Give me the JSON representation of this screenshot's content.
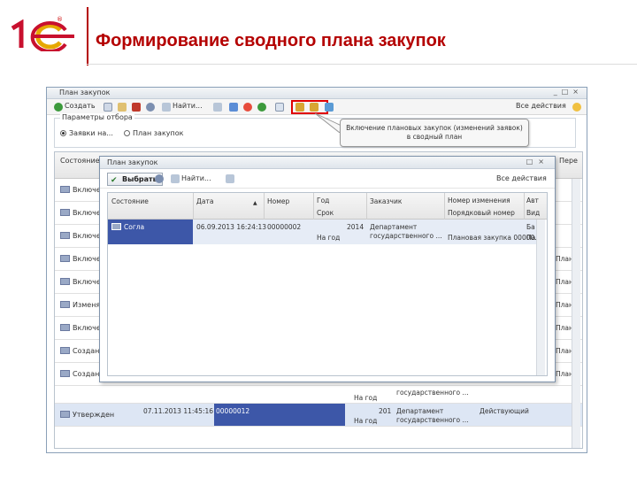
{
  "slide": {
    "title": "Формирование сводного плана закупок",
    "logo_text": "1С",
    "logo_mark": "®",
    "accent_color": "#b40000"
  },
  "main_window": {
    "title": "План закупок",
    "toolbar": {
      "create": "Создать",
      "find": "Найти...",
      "all_actions": "Все действия"
    },
    "filter": {
      "legend": "Параметры отбора",
      "option1": "Заявки на...",
      "option2": "План закупок"
    },
    "grid": {
      "header_state": "Состояние",
      "header_right": "Пере",
      "rows": [
        {
          "state": "Включе",
          "right": ""
        },
        {
          "state": "Включе",
          "right": ""
        },
        {
          "state": "Включе",
          "right": ""
        },
        {
          "state": "Включе",
          "right": "План"
        },
        {
          "state": "Включе",
          "right": "План"
        },
        {
          "state": "Изменя",
          "right": "План"
        },
        {
          "state": "Включе",
          "right": "План"
        },
        {
          "state": "Создан",
          "right": "План"
        },
        {
          "state": "Создан",
          "right": "План"
        }
      ],
      "selected_row": {
        "state": "Утвержден",
        "date": "07.11.2013 11:45:16",
        "number": "00000012",
        "year": "201",
        "line1": "На год",
        "line2": "На год",
        "customer1": "Департамент",
        "customer2": "государственного ...",
        "change_name": "Действующий"
      },
      "row_above_selected": {
        "line": "На год",
        "customer": "государственного ..."
      }
    }
  },
  "tooltip": {
    "line1": "Включение плановых закупок (изменений заявок)",
    "line2": "в сводный план"
  },
  "dialog": {
    "title": "План закупок",
    "pick_button": "Выбрать",
    "find": "Найти...",
    "all_actions": "Все действия",
    "columns": [
      "Состояние",
      "Дата",
      "Номер",
      "Год",
      "Заказчик",
      "Номер изменения",
      "Авт"
    ],
    "subcolumns": [
      "Срок",
      "Порядковый номер",
      "Вид"
    ],
    "row": {
      "state": "Согла",
      "date": "06.09.2013 16:24:13",
      "number": "00000002",
      "period": "На год",
      "year": "2014",
      "customer1": "Департамент",
      "customer2": "государственного ...",
      "change_name": "Плановая закупка 00000...",
      "auth1": "Ба",
      "auth2": "Па"
    }
  }
}
